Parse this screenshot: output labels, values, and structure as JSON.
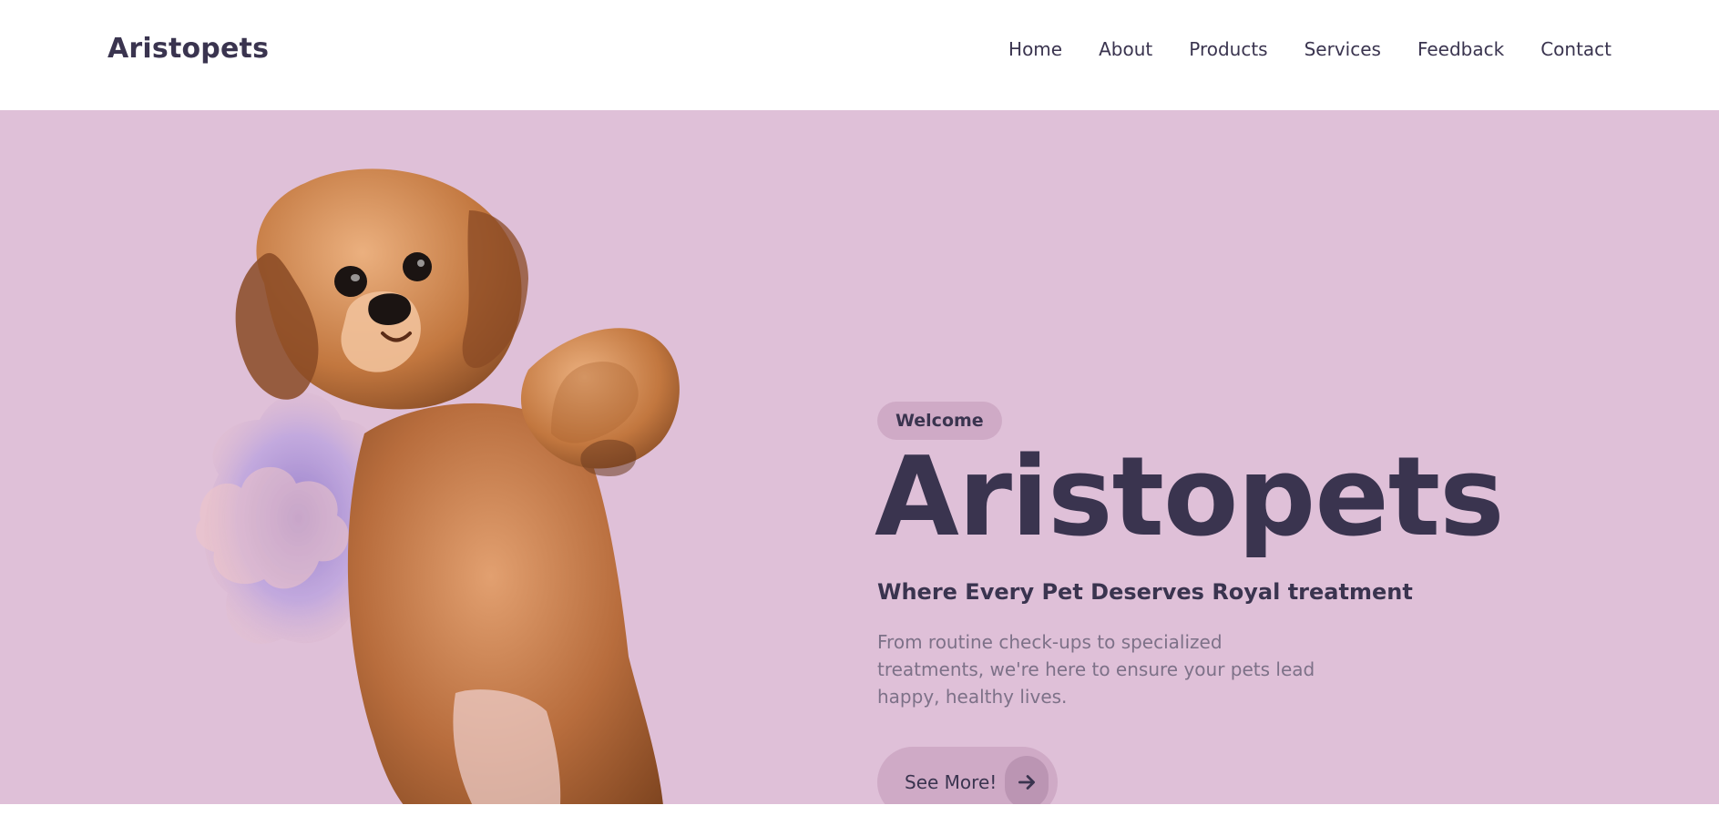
{
  "header": {
    "logo": "Aristopets",
    "nav": [
      "Home",
      "About",
      "Products",
      "Services",
      "Feedback",
      "Contact"
    ]
  },
  "hero": {
    "badge": "Welcome",
    "title": "Aristopets",
    "subtitle": "Where Every Pet Deserves Royal treatment",
    "description": "From routine check-ups to specialized treatments, we're here to ensure your pets lead happy, healthy lives.",
    "cta_label": "See More!",
    "cta_icon": "arrow-right-icon",
    "image": "dog-illustration"
  },
  "colors": {
    "primary_text": "#3a344f",
    "hero_bg": "#dfc0d8",
    "badge_bg": "#cfaac6",
    "muted_text": "#7d7188"
  }
}
